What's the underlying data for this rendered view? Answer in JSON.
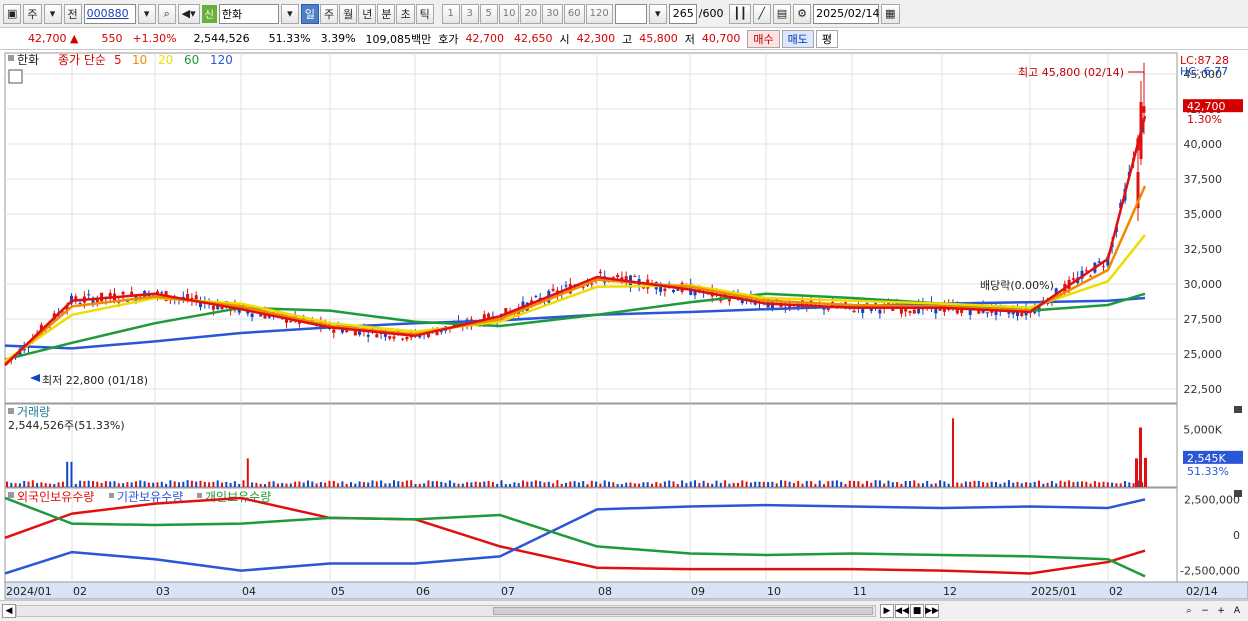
{
  "toolbar": {
    "period_main": "주",
    "period_prev": "전",
    "stock_code": "000880",
    "new_tag": "신",
    "stock_name": "한화",
    "period_tabs": [
      "일",
      "주",
      "월",
      "년",
      "분",
      "초",
      "틱"
    ],
    "active_tab": "일",
    "interval_buttons": [
      "1",
      "3",
      "5",
      "10",
      "20",
      "30",
      "60",
      "120"
    ],
    "count": "265",
    "count_total": "/600",
    "date": "2025/02/14"
  },
  "info": {
    "price": "42,700",
    "up_arrow": "▲",
    "change": "550",
    "change_pct": "+1.30%",
    "volume": "2,544,526",
    "volume_ratio": "51.33%",
    "turnover": "3.39%",
    "amount": "109,085백만",
    "bid_label": "호가",
    "ask_price": "42,700",
    "bid_price": "42,650",
    "open_label": "시",
    "open": "42,300",
    "high_label": "고",
    "high": "45,800",
    "low_label": "저",
    "low": "40,700",
    "buy_button": "매수",
    "sell_button": "매도",
    "eval_button": "평"
  },
  "price_panel": {
    "stock_label": "한화",
    "ma_title": "종가 단순",
    "ma_periods": [
      "5",
      "10",
      "20",
      "60",
      "120"
    ],
    "ma_colors": [
      "#e01010",
      "#f08a00",
      "#f0dc00",
      "#1f9a3a",
      "#2a56d8"
    ],
    "lc_label": "LC:87.28",
    "hc_label": "HC:-6.77",
    "high_annotation": "최고 45,800 (02/14)",
    "low_annotation": "최저 22,800 (01/18)",
    "dividend_annotation": "배당락(0.00%)",
    "current_price_tag": "42,700",
    "current_pct_tag": "1.30%"
  },
  "volume_panel": {
    "title": "거래량",
    "current": "2,544,526주(51.33%)",
    "axis_ticks": [
      "5,000K"
    ],
    "current_tag": "2,545K",
    "current_pct": "51.33%"
  },
  "holding_panel": {
    "legend": [
      "외국인보유수량",
      "기관보유수량",
      "개인보유수량"
    ],
    "colors": [
      "#e01010",
      "#2a56d8",
      "#1f9a3a"
    ],
    "axis_ticks": [
      "2,500,000",
      "0",
      "-2,500,000"
    ]
  },
  "x_axis": {
    "labels": [
      "2024/01",
      "02",
      "03",
      "04",
      "05",
      "06",
      "07",
      "08",
      "09",
      "10",
      "11",
      "12",
      "2025/01",
      "02"
    ],
    "end_label": "02/14"
  },
  "chart_data": {
    "type": "line",
    "title": "",
    "y_ticks": [
      "45,000",
      "42,500",
      "40,000",
      "37,500",
      "35,000",
      "32,500",
      "30,000",
      "27,500",
      "25,000",
      "22,500"
    ],
    "ylim": [
      21500,
      46500
    ],
    "x": [
      "2024/01",
      "02",
      "03",
      "04",
      "05",
      "06",
      "07",
      "08",
      "09",
      "10",
      "11",
      "12",
      "2025/01",
      "02",
      "02/14"
    ],
    "series": [
      {
        "name": "5",
        "values": [
          24200,
          28800,
          29300,
          28200,
          26900,
          26300,
          27700,
          30500,
          29600,
          28600,
          28300,
          28300,
          28000,
          31800,
          42000
        ]
      },
      {
        "name": "10",
        "values": [
          24300,
          28400,
          29100,
          28400,
          27000,
          26400,
          27500,
          30300,
          29800,
          28800,
          28500,
          28400,
          28100,
          31000,
          37000
        ]
      },
      {
        "name": "20",
        "values": [
          24500,
          27800,
          29000,
          28600,
          27200,
          26600,
          27300,
          29800,
          29900,
          29000,
          28800,
          28600,
          28300,
          30200,
          33500
        ]
      },
      {
        "name": "60",
        "values": [
          24600,
          25800,
          27200,
          28300,
          28100,
          27300,
          27000,
          27800,
          28700,
          29300,
          29000,
          28600,
          28100,
          28500,
          29300
        ]
      },
      {
        "name": "120",
        "values": [
          25600,
          25400,
          25900,
          26500,
          26900,
          27200,
          27400,
          27800,
          28000,
          28200,
          28400,
          28600,
          28700,
          28800,
          29000
        ]
      }
    ],
    "volume_peaks_k": [
      {
        "x": "02",
        "value": 2200
      },
      {
        "x": "04",
        "value": 2500
      },
      {
        "x": "12",
        "value": 6000
      },
      {
        "x": "02/14",
        "value": 5200
      }
    ],
    "holdings": [
      {
        "name": "외국인보유수량",
        "values": [
          -200000,
          1500000,
          2200000,
          2600000,
          1200000,
          1100000,
          -800000,
          -2300000,
          -2400000,
          -2400000,
          -2400000,
          -2500000,
          -2700000,
          -1900000,
          -1100000
        ]
      },
      {
        "name": "기관보유수량",
        "values": [
          -2700000,
          -1200000,
          -1700000,
          -2500000,
          -2000000,
          -2000000,
          -1500000,
          1800000,
          2000000,
          2100000,
          2000000,
          1900000,
          2000000,
          1900000,
          2500000
        ]
      },
      {
        "name": "개인보유수량",
        "values": [
          2600000,
          800000,
          700000,
          800000,
          1200000,
          1100000,
          1400000,
          -800000,
          -1300000,
          -1400000,
          -1300000,
          -1400000,
          -1500000,
          -1700000,
          -2900000
        ]
      }
    ]
  }
}
